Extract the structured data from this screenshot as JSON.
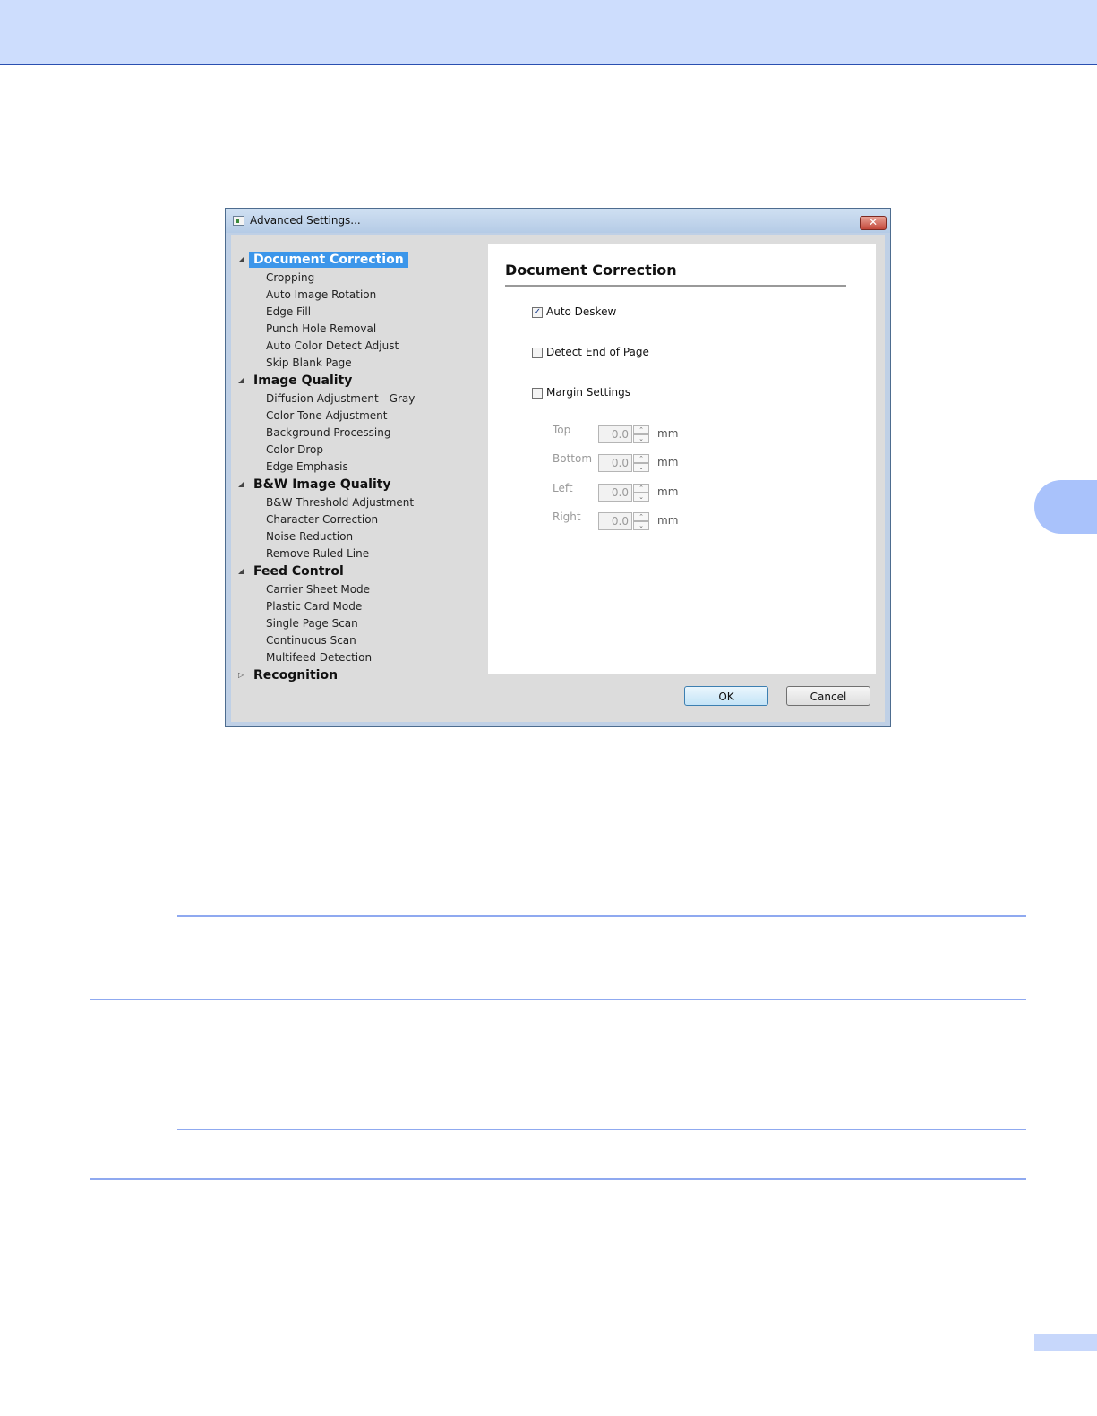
{
  "dialog": {
    "title": "Advanced Settings...",
    "close_glyph": "✕"
  },
  "tree": {
    "categories": [
      {
        "label": "Document Correction",
        "items": [
          "Cropping",
          "Auto Image Rotation",
          "Edge Fill",
          "Punch Hole Removal",
          "Auto Color Detect Adjust",
          "Skip Blank Page"
        ]
      },
      {
        "label": "Image Quality",
        "items": [
          "Diffusion Adjustment - Gray",
          "Color Tone Adjustment",
          "Background Processing",
          "Color Drop",
          "Edge Emphasis"
        ]
      },
      {
        "label": "B&W Image Quality",
        "items": [
          "B&W Threshold Adjustment",
          "Character Correction",
          "Noise Reduction",
          "Remove Ruled Line"
        ]
      },
      {
        "label": "Feed Control",
        "items": [
          "Carrier Sheet Mode",
          "Plastic Card Mode",
          "Single Page Scan",
          "Continuous Scan",
          "Multifeed Detection"
        ]
      },
      {
        "label": "Recognition",
        "items": []
      }
    ],
    "expanded_glyph": "◢",
    "collapsed_glyph": "▷"
  },
  "panel": {
    "title": "Document Correction",
    "auto_deskew": {
      "label": "Auto Deskew",
      "checked": true,
      "check_glyph": "✓"
    },
    "detect_end": {
      "label": "Detect End of Page",
      "checked": false
    },
    "margin_settings": {
      "label": "Margin Settings",
      "checked": false
    },
    "margins": {
      "top": {
        "label": "Top",
        "value": "0.0"
      },
      "bottom": {
        "label": "Bottom",
        "value": "0.0"
      },
      "left": {
        "label": "Left",
        "value": "0.0"
      },
      "right": {
        "label": "Right",
        "value": "0.0"
      },
      "unit": "mm",
      "up_glyph": "⌃",
      "down_glyph": "⌄"
    }
  },
  "buttons": {
    "ok": "OK",
    "cancel": "Cancel"
  }
}
